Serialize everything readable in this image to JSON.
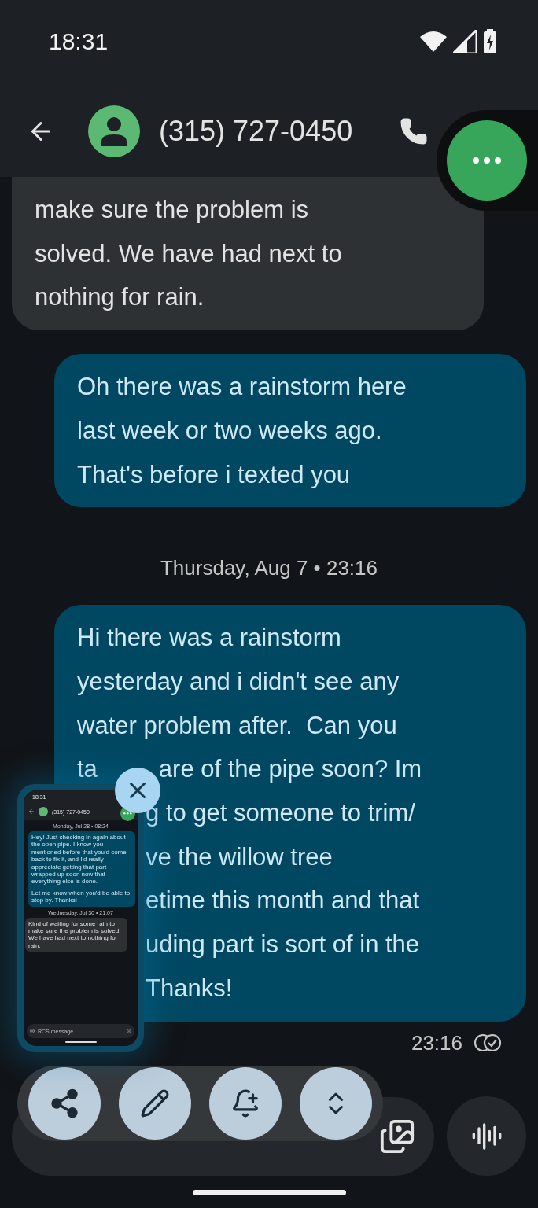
{
  "status_bar": {
    "time": "18:31"
  },
  "header": {
    "contact": "(315) 727-0450"
  },
  "messages": [
    {
      "kind": "received",
      "lines": [
        [
          "make sure the problem is"
        ],
        [
          "solved. We have had next to"
        ],
        [
          "nothing for rain."
        ]
      ]
    },
    {
      "kind": "sent",
      "lines": [
        [
          "Oh there was a rainstorm here"
        ],
        [
          "last week or two weeks ago."
        ],
        [
          "That's before i texted you"
        ]
      ]
    },
    {
      "kind": "date",
      "text": "Thursday, Aug 7 • 23:16"
    },
    {
      "kind": "sent",
      "lines": [
        [
          "Hi there was a rainstorm"
        ],
        [
          "yesterday and i didn't see any"
        ],
        [
          "water problem after.  Can you"
        ],
        [
          "ta",
          "are of the pipe soon? Im"
        ],
        [
          "g to get someone to trim/"
        ],
        [
          "ve the willow tree"
        ],
        [
          "etime this month and that"
        ],
        [
          "uding part is sort of in the"
        ],
        [
          "Thanks!"
        ]
      ]
    }
  ],
  "last_message_time": "23:16",
  "screenshot_preview": {
    "time": "18:31",
    "contact": "(315) 727-0450",
    "items": [
      {
        "kind": "date",
        "text": "Monday, Jul 28 • 08:24"
      },
      {
        "kind": "sent",
        "paragraphs": [
          "Hey! Just checking in again about the open pipe. I know you mentioned before that you'd come back to fix it, and I'd really appreciate getting that part wrapped up soon now that everything else is done.",
          "Let me know when you'd be able to stop by. Thanks!"
        ]
      },
      {
        "kind": "date",
        "text": "Wednesday, Jul 30 • 21:07"
      },
      {
        "kind": "received",
        "paragraphs": [
          "Kind of waiting for some rain to make sure the problem is solved. We have had next to nothing for rain."
        ]
      }
    ],
    "compose_placeholder": "RCS message"
  }
}
